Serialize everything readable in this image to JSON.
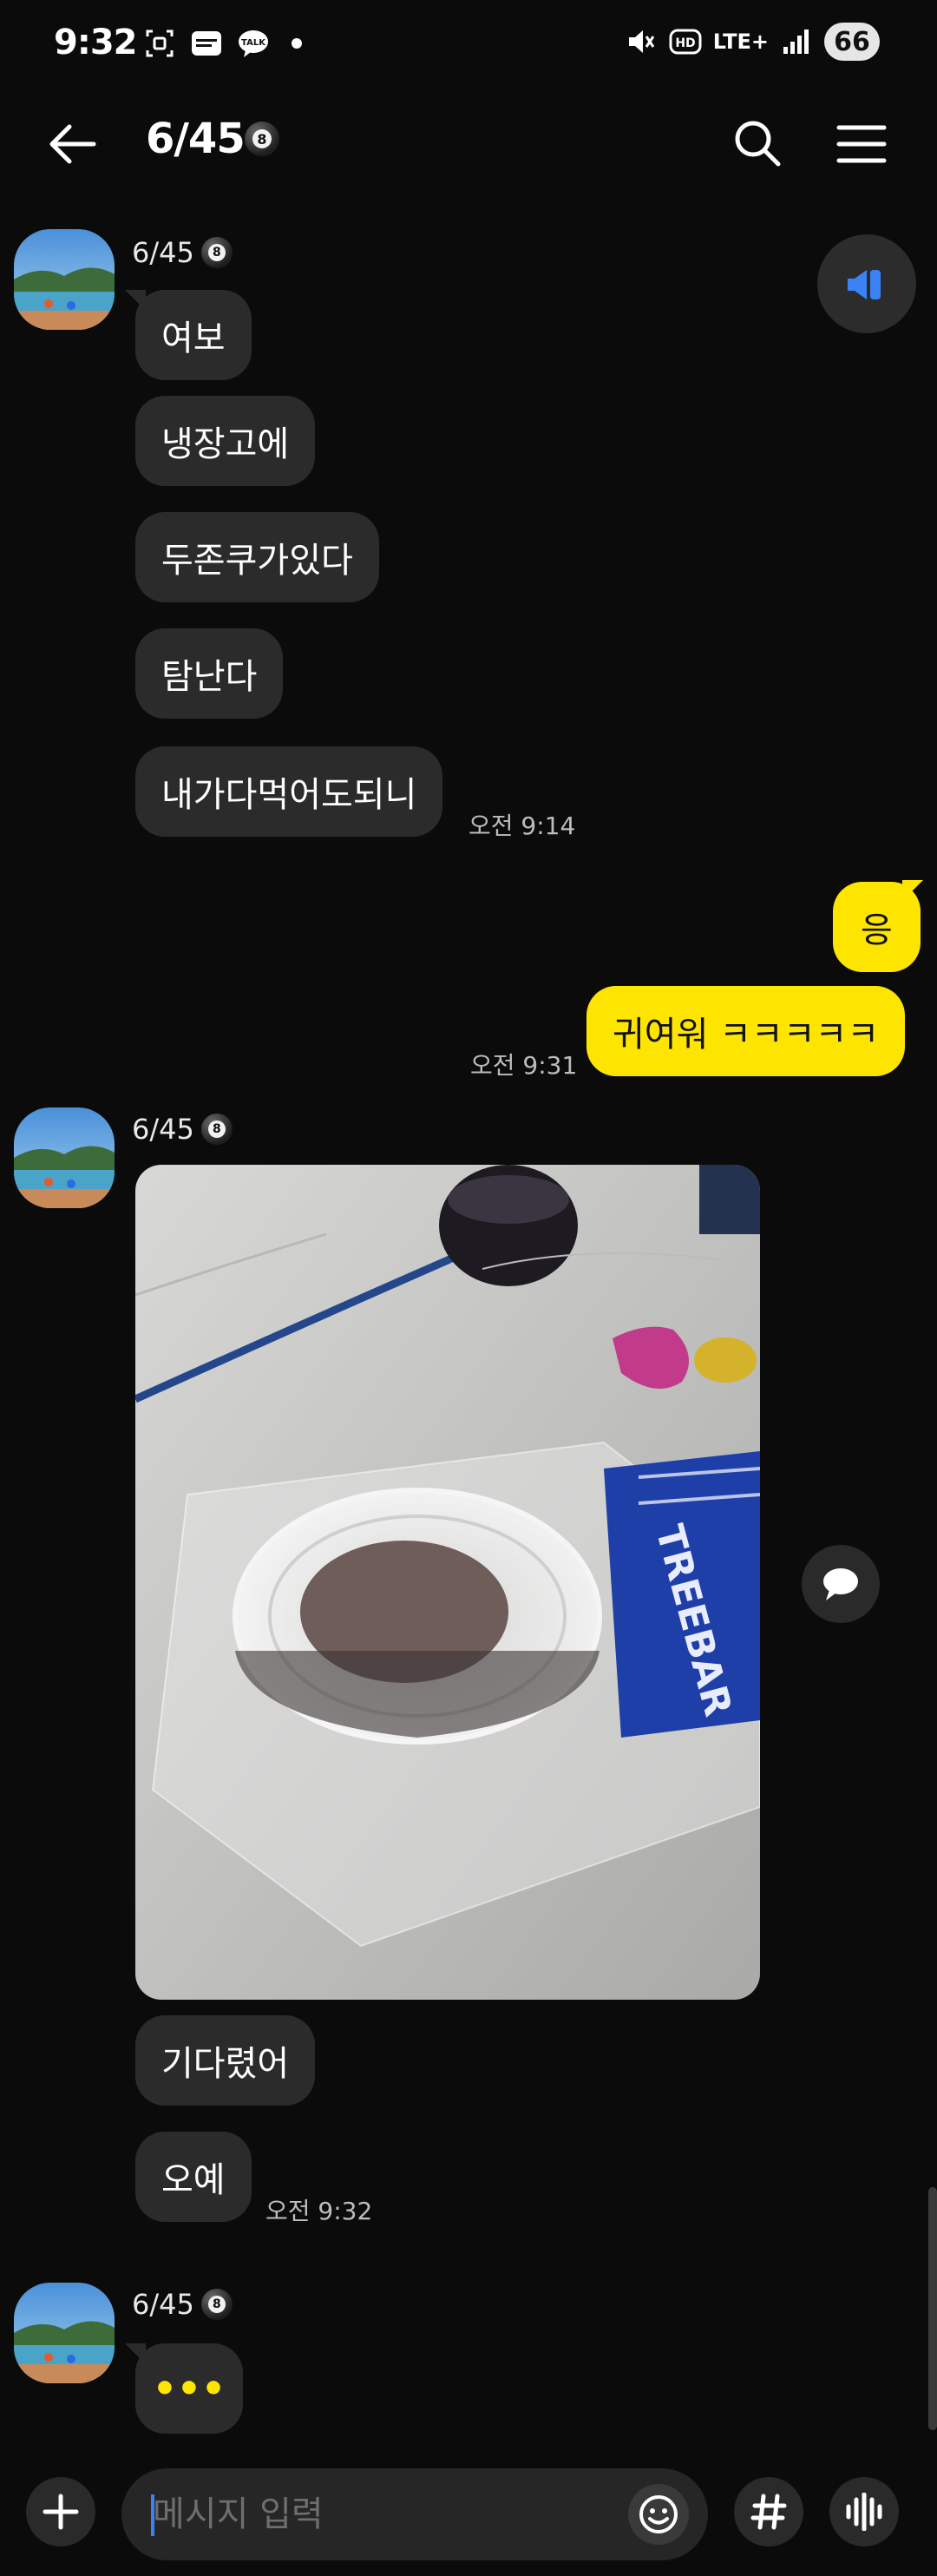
{
  "status_bar": {
    "time": "9:32",
    "network": "LTE+",
    "hd_label": "HD",
    "battery": "66",
    "icons": [
      "screenshot-icon",
      "trauma-manager-icon",
      "talk-icon",
      "dot-icon",
      "mute-icon",
      "hd-icon",
      "lte-icon",
      "signal-icon",
      "battery-icon"
    ]
  },
  "header": {
    "title": "6/45",
    "badge": "8",
    "icons": [
      "back-arrow-icon",
      "search-icon",
      "menu-icon"
    ]
  },
  "messages": {
    "group1": {
      "sender": "6/45",
      "badge": "8",
      "texts": [
        "여보",
        "냉장고에",
        "두존쿠가있다",
        "탐난다",
        "내가다먹어도되니"
      ],
      "time": "오전 9:14"
    },
    "group2": {
      "texts": [
        "응",
        "귀여워 ㅋㅋㅋㅋㅋ"
      ],
      "time": "오전 9:31"
    },
    "group3": {
      "sender": "6/45",
      "badge": "8",
      "photo_caption": "TREEBAR",
      "texts": [
        "기다렸어",
        "오예"
      ],
      "time": "오전 9:32"
    },
    "group4": {
      "sender": "6/45",
      "badge": "8",
      "typing": "•••"
    }
  },
  "input": {
    "placeholder": "메시지 입력",
    "value": ""
  },
  "colors": {
    "background": "#0b0b0b",
    "bubble_other": "#2b2b2b",
    "bubble_me": "#fde500",
    "accent_blue": "#3b82f6"
  }
}
